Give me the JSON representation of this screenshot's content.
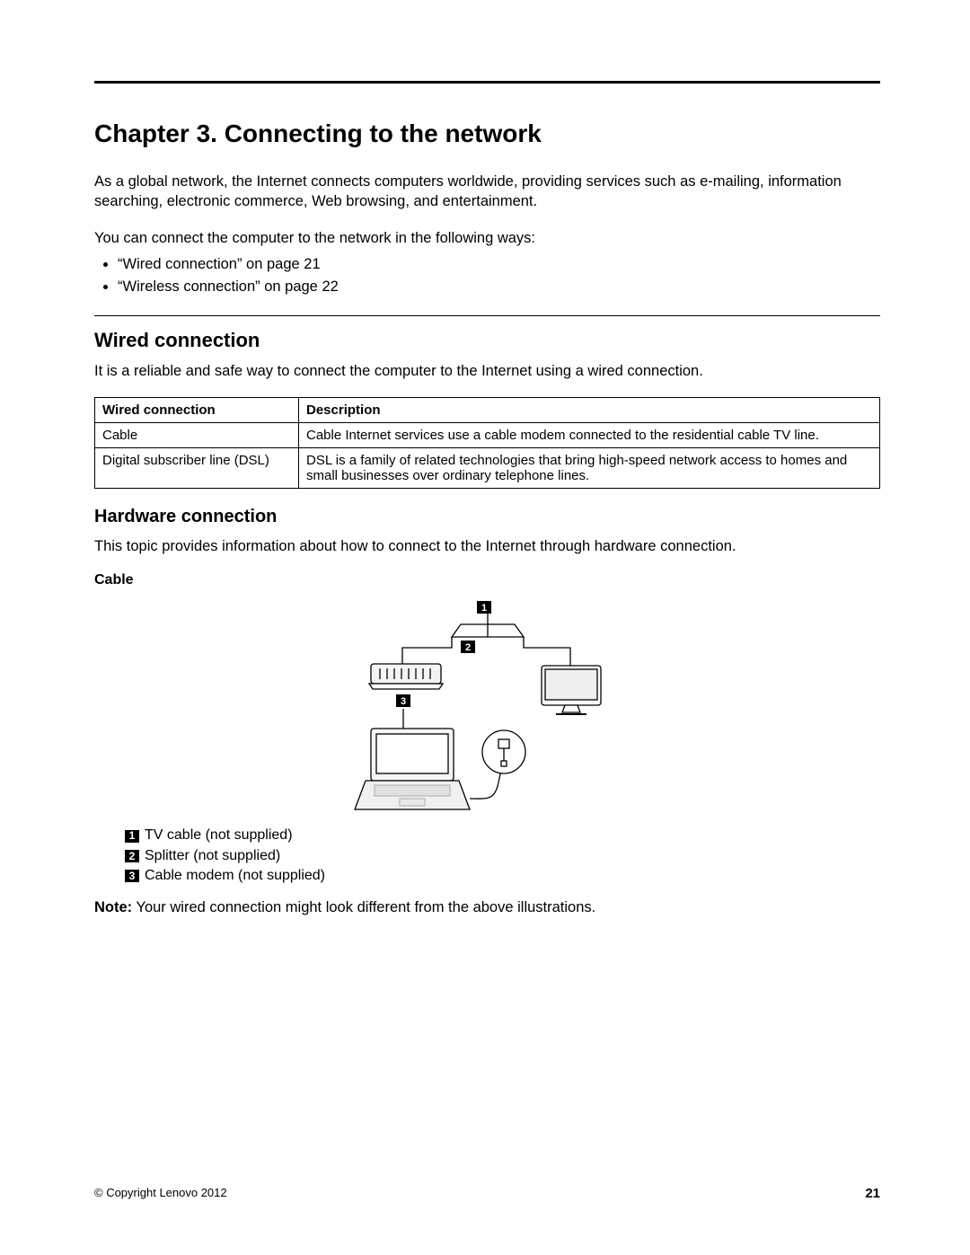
{
  "chapter": {
    "title": "Chapter 3.   Connecting to the network",
    "intro1": "As a global network, the Internet connects computers worldwide, providing services such as e-mailing, information searching, electronic commerce, Web browsing, and entertainment.",
    "intro2": "You can connect the computer to the network in the following ways:",
    "bullets": [
      "“Wired connection” on page 21",
      "“Wireless connection” on page 22"
    ]
  },
  "wired": {
    "heading": "Wired connection",
    "intro": "It is a reliable and safe way to connect the computer to the Internet using a wired connection.",
    "table": {
      "headers": [
        "Wired connection",
        "Description"
      ],
      "rows": [
        [
          "Cable",
          "Cable Internet services use a cable modem connected to the residential cable TV line."
        ],
        [
          "Digital subscriber line (DSL)",
          "DSL is a family of related technologies that bring high-speed network access to homes and small businesses over ordinary telephone lines."
        ]
      ]
    }
  },
  "hardware": {
    "heading": "Hardware connection",
    "intro": "This topic provides information about how to connect to the Internet through hardware connection.",
    "sub_heading": "Cable",
    "legend": [
      {
        "num": "1",
        "text": "TV cable (not supplied)"
      },
      {
        "num": "2",
        "text": "Splitter (not supplied)"
      },
      {
        "num": "3",
        "text": "Cable modem (not supplied)"
      }
    ],
    "note_label": "Note:",
    "note_text": " Your wired connection might look different from the above illustrations."
  },
  "footer": {
    "copyright": "© Copyright Lenovo 2012",
    "page": "21"
  }
}
